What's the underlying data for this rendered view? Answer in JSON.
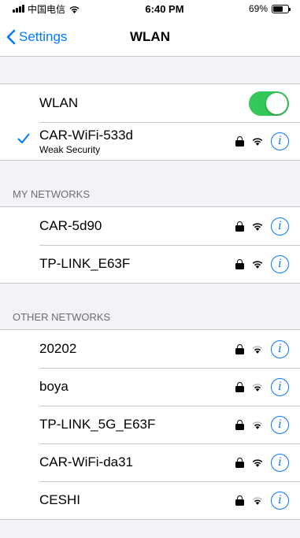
{
  "status_bar": {
    "carrier": "中国电信",
    "time": "6:40 PM",
    "battery": "69%",
    "battery_level": 0.69
  },
  "nav": {
    "back_label": "Settings",
    "title": "WLAN"
  },
  "wlan_row": {
    "label": "WLAN",
    "enabled": true
  },
  "connected": {
    "name": "CAR-WiFi-533d",
    "subtitle": "Weak Security"
  },
  "my_networks": {
    "header": "MY NETWORKS",
    "items": [
      {
        "name": "CAR-5d90"
      },
      {
        "name": "TP-LINK_E63F"
      }
    ]
  },
  "other_networks": {
    "header": "OTHER NETWORKS",
    "items": [
      {
        "name": "20202",
        "signal": 2
      },
      {
        "name": "boya",
        "signal": 2
      },
      {
        "name": "TP-LINK_5G_E63F",
        "signal": 2
      },
      {
        "name": "CAR-WiFi-da31",
        "signal": 3
      },
      {
        "name": "CESHI",
        "signal": 2
      }
    ]
  },
  "colors": {
    "accent": "#007aff",
    "toggle_on": "#34c759"
  }
}
